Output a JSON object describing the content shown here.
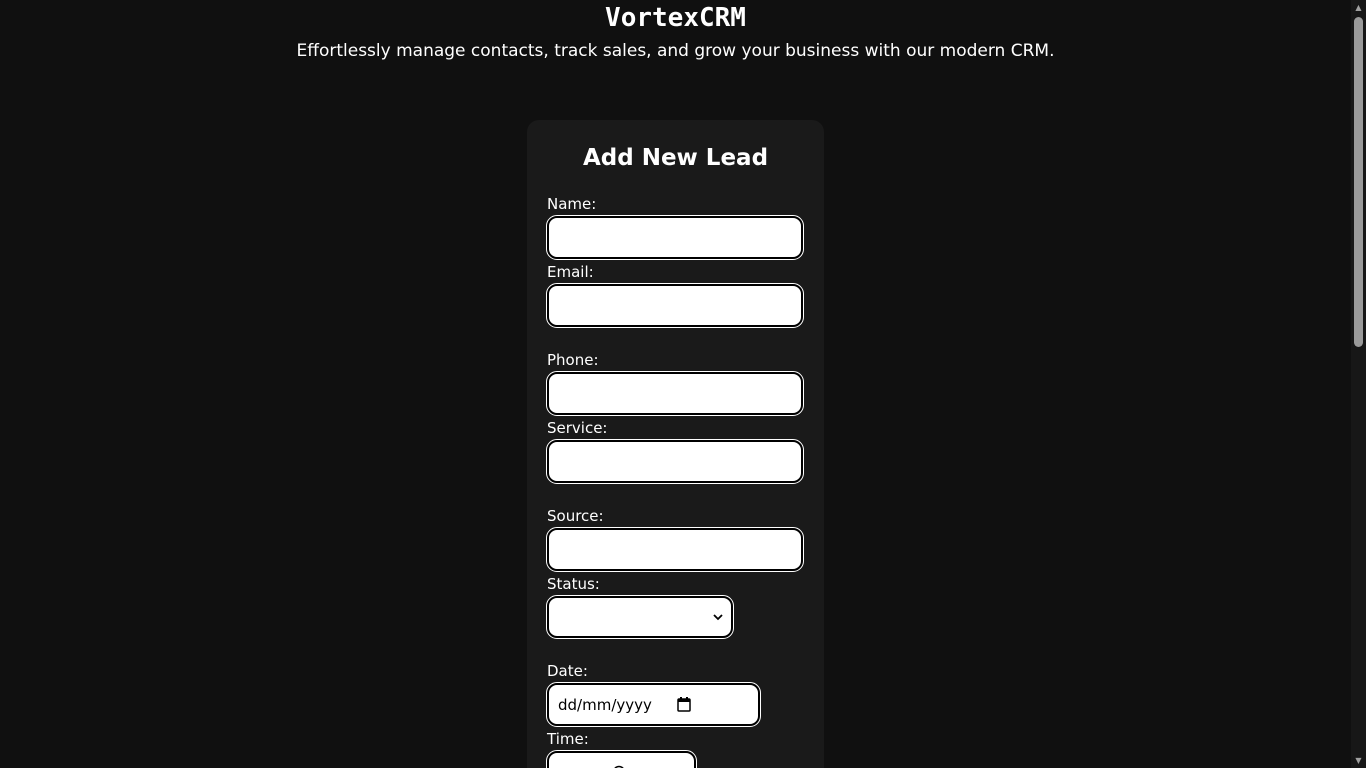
{
  "app": {
    "title": "VortexCRM",
    "tagline": "Effortlessly manage contacts, track sales, and grow your business with our modern CRM."
  },
  "form": {
    "title": "Add New Lead",
    "fields": {
      "name": {
        "label": "Name:",
        "value": ""
      },
      "email": {
        "label": "Email:",
        "value": ""
      },
      "phone": {
        "label": "Phone:",
        "value": ""
      },
      "service": {
        "label": "Service:",
        "value": ""
      },
      "source": {
        "label": "Source:",
        "value": ""
      },
      "status": {
        "label": "Status:",
        "selected": ""
      },
      "date": {
        "label": "Date:",
        "placeholder": "dd/mm/yyyy"
      },
      "time": {
        "label": "Time:"
      }
    }
  },
  "colors": {
    "background": "#101010",
    "card": "#1a1a1a",
    "text": "#ffffff",
    "input_bg": "#ffffff"
  },
  "icons": {
    "date_picker": "calendar-icon",
    "time_picker": "clock-icon",
    "select_arrow": "chevron-down-icon"
  }
}
